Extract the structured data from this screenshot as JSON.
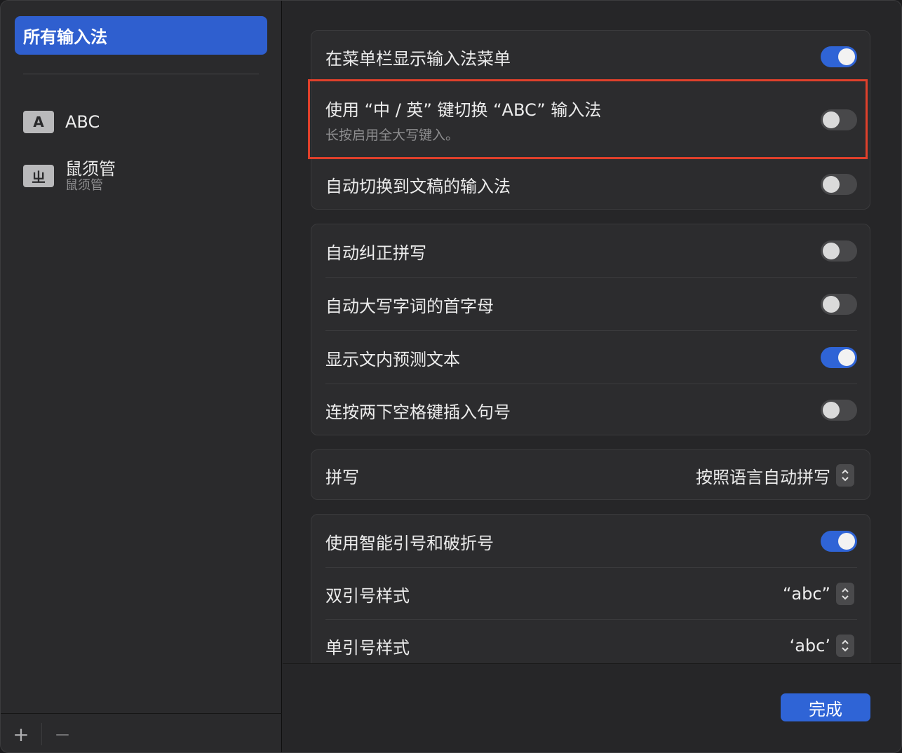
{
  "sidebar": {
    "header_label": "所有输入法",
    "items": [
      {
        "icon_glyph": "A",
        "icon": "letter-a-icon",
        "title": "ABC",
        "subtitle": ""
      },
      {
        "icon_glyph": "ㄓ",
        "icon": "rime-icon",
        "title": "鼠须管",
        "subtitle": "鼠须管"
      }
    ],
    "add_label": "+",
    "remove_label": "−"
  },
  "groups": {
    "menu": {
      "rows": [
        {
          "label": "在菜单栏显示输入法菜单",
          "toggle": true
        },
        {
          "label": "使用 “中 / 英” 键切换 “ABC” 输入法",
          "sublabel": "长按启用全大写键入。",
          "toggle": false
        },
        {
          "label": "自动切换到文稿的输入法",
          "toggle": false
        }
      ]
    },
    "typing": {
      "rows": [
        {
          "label": "自动纠正拼写",
          "toggle": false
        },
        {
          "label": "自动大写字词的首字母",
          "toggle": false
        },
        {
          "label": "显示文内预测文本",
          "toggle": true
        },
        {
          "label": "连按两下空格键插入句号",
          "toggle": false
        }
      ]
    },
    "spelling": {
      "label": "拼写",
      "value": "按照语言自动拼写"
    },
    "quotes": {
      "smart_label": "使用智能引号和破折号",
      "smart_toggle": true,
      "double_label": "双引号样式",
      "double_value": "“abc”",
      "single_label": "单引号样式",
      "single_value": "‘abc’"
    }
  },
  "footer": {
    "done_label": "完成"
  },
  "colors": {
    "accent": "#2f64d6",
    "highlight_border": "#e0402b",
    "window_bg": "#262628",
    "group_bg": "#2c2c2e"
  }
}
